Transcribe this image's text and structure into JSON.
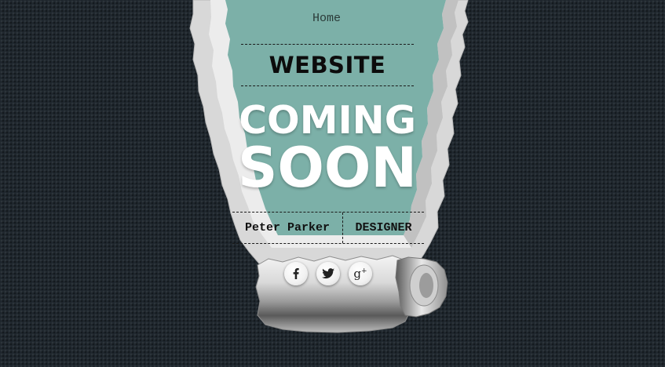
{
  "nav": {
    "home_label": "Home"
  },
  "hero": {
    "website_label": "WEBSITE",
    "coming_label": "COMING",
    "soon_label": "SOON"
  },
  "credits": {
    "name": "Peter Parker",
    "role": "DESIGNER"
  },
  "social": {
    "facebook_icon": "facebook-icon",
    "twitter_icon": "twitter-icon",
    "googleplus_icon": "google-plus-icon",
    "googleplus_glyph": "g",
    "googleplus_sup": "+"
  },
  "colors": {
    "background": "#1f272e",
    "teal": "#7cb0a8",
    "paper": "#dcdcdc"
  }
}
